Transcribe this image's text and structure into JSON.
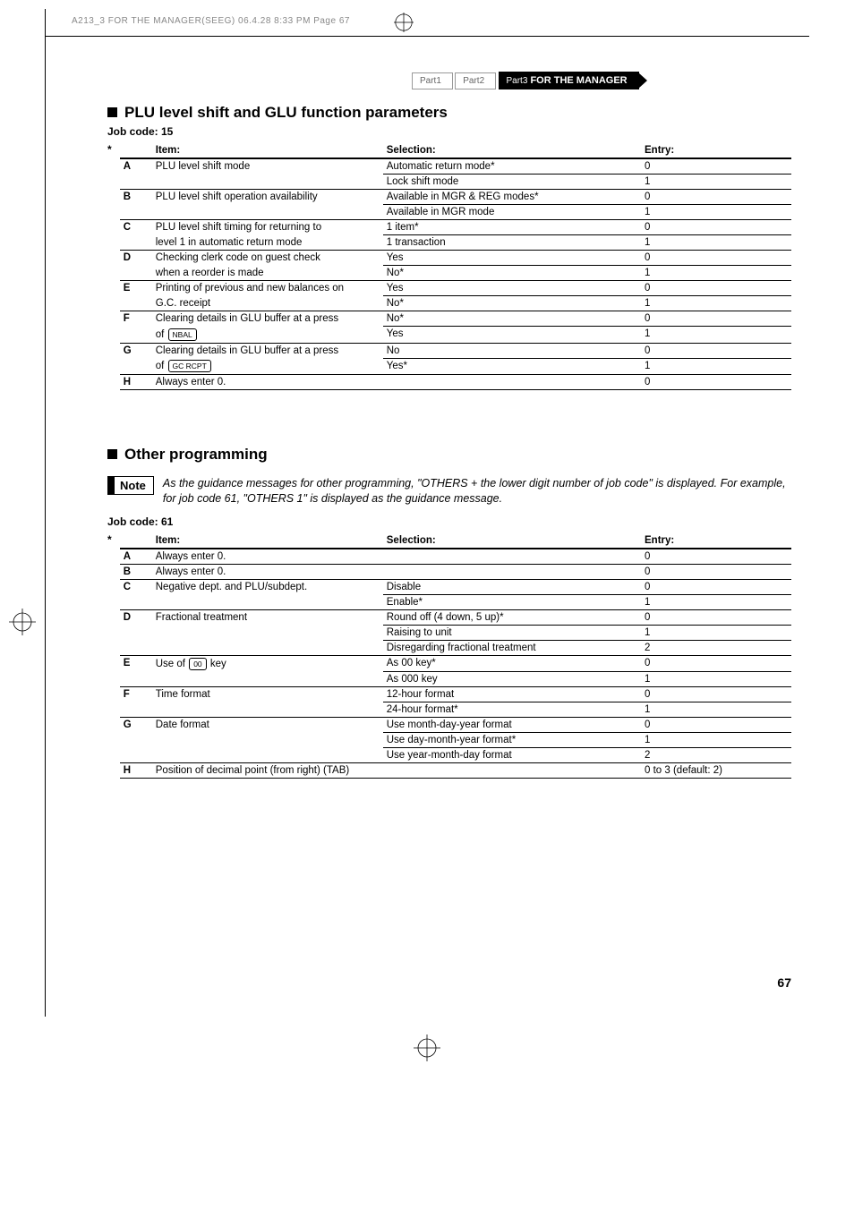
{
  "header_line": "A213_3 FOR THE MANAGER(SEEG)  06.4.28 8:33 PM  Page 67",
  "breadcrumb": {
    "part1": "Part1",
    "part2": "Part2",
    "part3_prefix": "Part3",
    "part3_label": " FOR THE MANAGER"
  },
  "section1": {
    "title": "PLU level shift and GLU function parameters",
    "job_code": "Job code:  15",
    "headers": {
      "item": "Item:",
      "selection": "Selection:",
      "entry": "Entry:"
    },
    "rows": [
      {
        "letter": "A",
        "desc": "PLU level shift mode",
        "sel": "Automatic return mode*",
        "entry": "0",
        "cont": true
      },
      {
        "letter": "",
        "desc": "",
        "sel": "Lock shift mode",
        "entry": "1"
      },
      {
        "letter": "B",
        "desc": "PLU level shift operation availability",
        "sel": "Available in MGR & REG modes*",
        "entry": "0",
        "cont": true
      },
      {
        "letter": "",
        "desc": "",
        "sel": "Available in MGR mode",
        "entry": "1"
      },
      {
        "letter": "C",
        "desc": "PLU level shift timing for returning to",
        "sel": "1 item*",
        "entry": "0",
        "cont": true
      },
      {
        "letter": "",
        "desc": "level 1 in automatic return mode",
        "sel": "1 transaction",
        "entry": "1"
      },
      {
        "letter": "D",
        "desc": "Checking clerk code on guest check",
        "sel": "Yes",
        "entry": "0",
        "cont": true
      },
      {
        "letter": "",
        "desc": "when a reorder is made",
        "sel": "No*",
        "entry": "1"
      },
      {
        "letter": "E",
        "desc": "Printing of previous and new balances on",
        "sel": "Yes",
        "entry": "0",
        "cont": true
      },
      {
        "letter": "",
        "desc": "G.C. receipt",
        "sel": "No*",
        "entry": "1"
      },
      {
        "letter": "F",
        "desc_prefix": "Clearing details in GLU buffer at a press",
        "desc_key_line": "of ",
        "key": "NBAL",
        "sel1": "No*",
        "entry1": "0",
        "sel2": "Yes",
        "entry2": "1",
        "is_key_row": true
      },
      {
        "letter": "G",
        "desc_prefix": "Clearing details in GLU buffer at a press",
        "desc_key_line": "of ",
        "key": "GC RCPT",
        "sel1": "No",
        "entry1": "0",
        "sel2": "Yes*",
        "entry2": "1",
        "is_key_row": true
      },
      {
        "letter": "H",
        "desc": "Always enter 0.",
        "sel": "",
        "entry": "0"
      }
    ]
  },
  "section2": {
    "title": "Other programming",
    "note_label": "Note",
    "note_text": "As the guidance messages for other programming, \"OTHERS + the lower digit number of job code\" is displayed.  For example, for job code 61, \"OTHERS 1\" is displayed as the guidance message.",
    "job_code": "Job code:  61",
    "headers": {
      "item": "Item:",
      "selection": "Selection:",
      "entry": "Entry:"
    },
    "rows": [
      {
        "letter": "A",
        "desc": "Always enter 0.",
        "sel": "",
        "entry": "0"
      },
      {
        "letter": "B",
        "desc": "Always enter 0.",
        "sel": "",
        "entry": "0"
      },
      {
        "letter": "C",
        "desc": "Negative dept. and PLU/subdept.",
        "sel": "Disable",
        "entry": "0",
        "cont": true
      },
      {
        "letter": "",
        "desc": "",
        "sel": "Enable*",
        "entry": "1"
      },
      {
        "letter": "D",
        "desc": "Fractional treatment",
        "sel": "Round off (4 down, 5 up)*",
        "entry": "0",
        "cont": true
      },
      {
        "letter": "",
        "desc": "",
        "sel": "Raising to unit",
        "entry": "1",
        "cont": true
      },
      {
        "letter": "",
        "desc": "",
        "sel": "Disregarding fractional treatment",
        "entry": "2"
      },
      {
        "letter": "E",
        "desc_prefix": "Use of ",
        "key": "00",
        "desc_suffix": " key",
        "sel": "As 00 key*",
        "entry": "0",
        "is_inline_key": true,
        "cont": true
      },
      {
        "letter": "",
        "desc": "",
        "sel": "As 000 key",
        "entry": "1"
      },
      {
        "letter": "F",
        "desc": "Time format",
        "sel": "12-hour format",
        "entry": "0",
        "cont": true
      },
      {
        "letter": "",
        "desc": "",
        "sel": "24-hour format*",
        "entry": "1"
      },
      {
        "letter": "G",
        "desc": "Date format",
        "sel": "Use month-day-year format",
        "entry": "0",
        "cont": true
      },
      {
        "letter": "",
        "desc": "",
        "sel": "Use day-month-year format*",
        "entry": "1",
        "cont": true
      },
      {
        "letter": "",
        "desc": "",
        "sel": "Use year-month-day format",
        "entry": "2"
      },
      {
        "letter": "H",
        "desc": "Position of decimal point (from right) (TAB)",
        "sel": "",
        "entry": "0 to 3 (default: 2)"
      }
    ]
  },
  "page_number": "67",
  "star": "*"
}
